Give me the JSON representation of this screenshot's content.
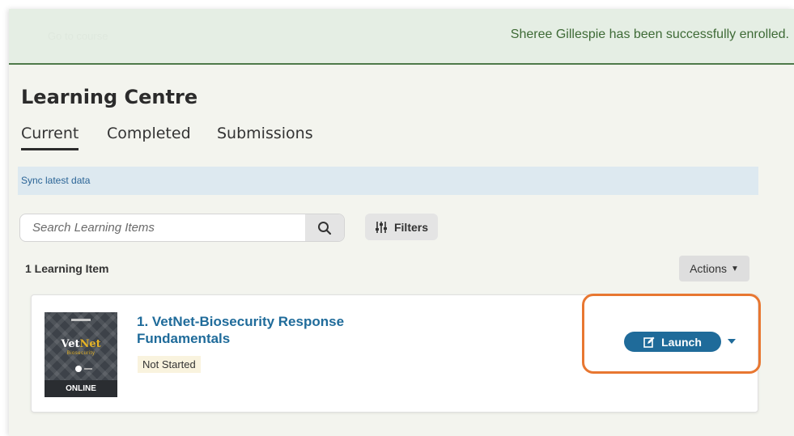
{
  "banner": {
    "message": "Sheree Gillespie has been successfully enrolled.",
    "faded_text": "Go to course"
  },
  "page": {
    "title": "Learning Centre",
    "tabs": [
      {
        "label": "Current",
        "active": true
      },
      {
        "label": "Completed",
        "active": false
      },
      {
        "label": "Submissions",
        "active": false
      }
    ]
  },
  "sync": {
    "label": "Sync latest data"
  },
  "search": {
    "placeholder": "Search Learning Items",
    "value": "",
    "icon": "search-icon"
  },
  "filters": {
    "label": "Filters",
    "icon": "sliders-icon"
  },
  "list": {
    "count_label": "1 Learning Item",
    "actions_label": "Actions"
  },
  "items": [
    {
      "title": "1. VetNet-Biosecurity Response Fundamentals",
      "status": "Not Started",
      "thumbnail": {
        "logo_a": "Vet",
        "logo_b": "Net",
        "subtitle": "Biosecurity",
        "format": "ONLINE"
      },
      "launch_label": "Launch",
      "launch_icon": "edit-icon"
    }
  ],
  "colors": {
    "accent": "#1f6b9a",
    "success_text": "#3e6a36",
    "highlight": "#e87731"
  }
}
